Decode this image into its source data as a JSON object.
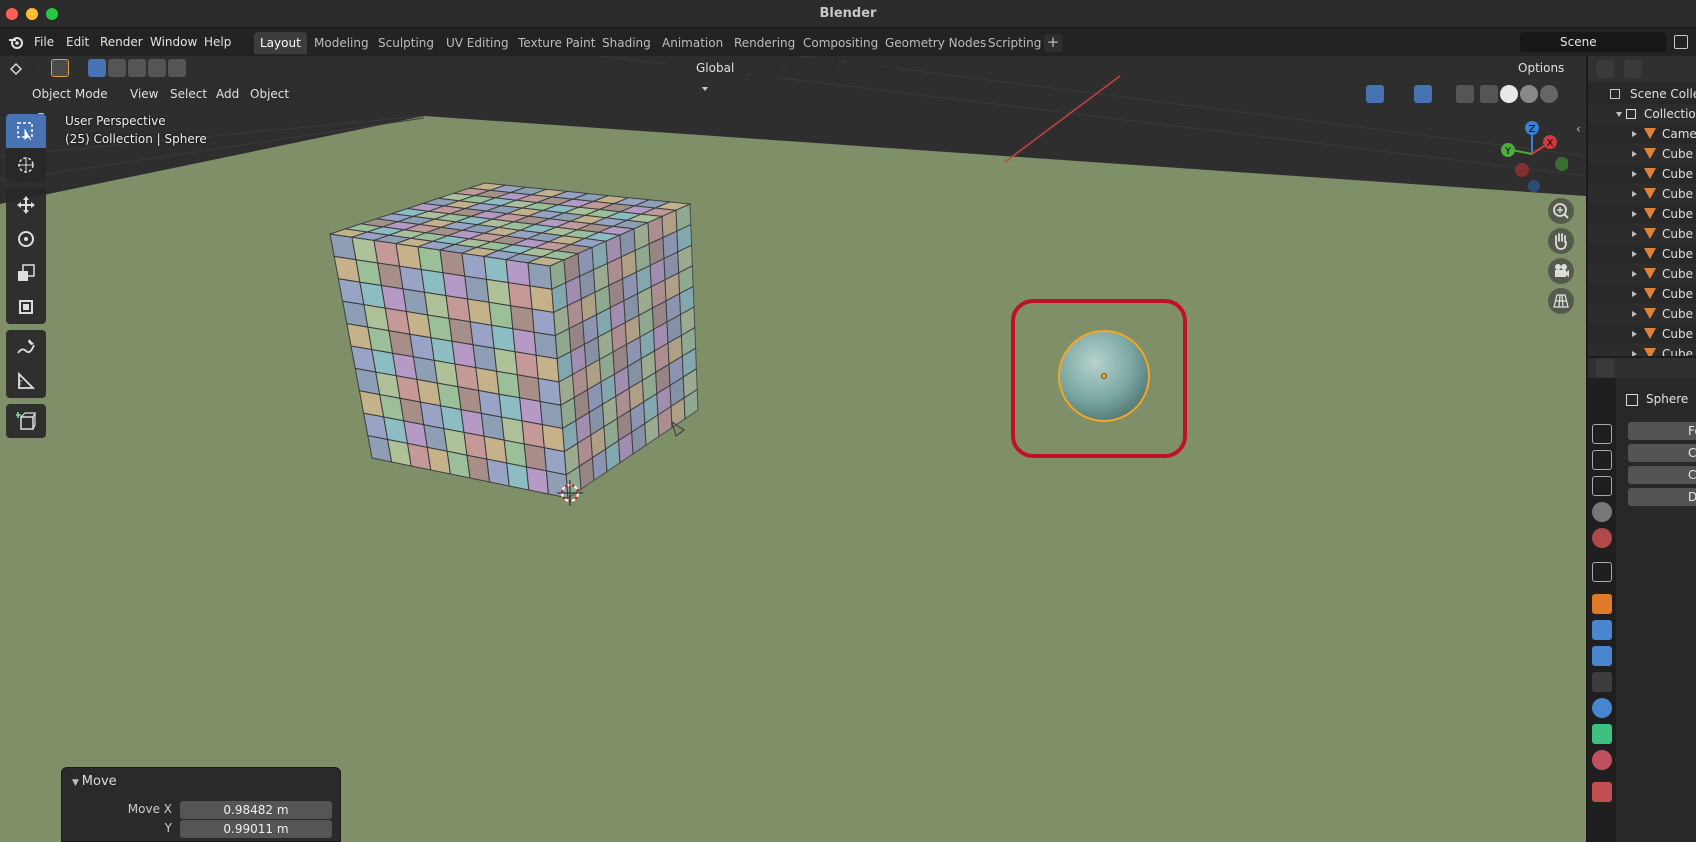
{
  "window": {
    "title": "Blender"
  },
  "menu": {
    "items": [
      "File",
      "Edit",
      "Render",
      "Window",
      "Help"
    ]
  },
  "workspaces": {
    "tabs": [
      "Layout",
      "Modeling",
      "Sculpting",
      "UV Editing",
      "Texture Paint",
      "Shading",
      "Animation",
      "Rendering",
      "Compositing",
      "Geometry Nodes",
      "Scripting"
    ],
    "active": "Layout",
    "add_symbol": "+"
  },
  "scene": {
    "name": "Scene"
  },
  "toolbar_header": {
    "transform_orientation": "Global",
    "options_label": "Options"
  },
  "viewport_header": {
    "mode": "Object Mode",
    "menus": [
      "View",
      "Select",
      "Add",
      "Object"
    ]
  },
  "viewport": {
    "perspective": "User Perspective",
    "collection_info": "(25) Collection | Sphere"
  },
  "redo_panel": {
    "title": "Move",
    "fields": [
      {
        "label": "Move X",
        "value": "0.98482 m"
      },
      {
        "label": "Y",
        "value": "0.99011 m"
      }
    ]
  },
  "gizmo": {
    "x": "X",
    "y": "Y",
    "z": "Z"
  },
  "outliner": {
    "root": "Scene Collection",
    "collection": "Collection",
    "items": [
      "Camera",
      "Cube",
      "Cube",
      "Cube",
      "Cube",
      "Cube",
      "Cube",
      "Cube",
      "Cube",
      "Cube",
      "Cube",
      "Cube"
    ]
  },
  "properties": {
    "object_name": "Sphere",
    "physics_buttons": [
      "Force Field",
      "Collision",
      "Cloth",
      "Dynamic Paint"
    ]
  },
  "colors": {
    "accent": "#4772b3",
    "ground": "#7f8f68",
    "highlight_box": "#c0102a",
    "selection": "#f5a623",
    "sphere": "#7aa7a2"
  },
  "icons": [
    "blender-logo-icon",
    "select-box-icon",
    "cursor-icon",
    "move-icon",
    "rotate-icon",
    "scale-icon",
    "transform-icon",
    "annotate-icon",
    "measure-icon",
    "add-cube-icon",
    "zoom-icon",
    "hand-pan-icon",
    "camera-icon",
    "ortho-grid-icon"
  ]
}
